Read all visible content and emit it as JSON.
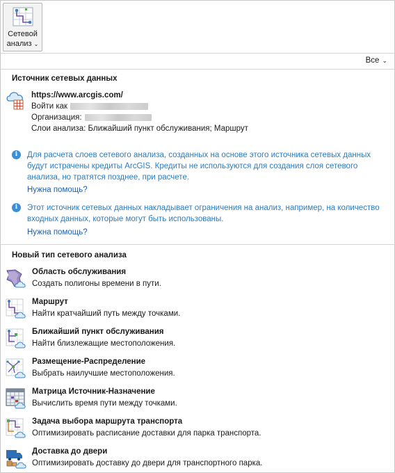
{
  "ribbon": {
    "button_line1": "Сетевой",
    "button_line2": "анализ",
    "button_icon": "network-grid-icon"
  },
  "filter": {
    "label": "Все"
  },
  "source": {
    "section_title": "Источник сетевых данных",
    "url": "https://www.arcgis.com/",
    "login_prefix": "Войти как",
    "org_prefix": "Организация:",
    "layers": "Слои анализа: Ближайший пункт обслуживания; Маршрут",
    "icon": "cloud-network-icon",
    "info1": "Для расчета слоев сетевого анализа, созданных на основе этого источника сетевых данных будут истрачены кредиты ArcGIS. Кредиты не используются для создания слоя сетевого анализа, но тратятся позднее, при расчете.",
    "help1": "Нужна помощь?",
    "info2": "Этот источник сетевых данных накладывает ограничения на анализ, например, на количество входных данных, которые могут быть использованы.",
    "help2": "Нужна помощь?"
  },
  "analysis": {
    "section_title": "Новый тип сетевого анализа",
    "items": [
      {
        "name": "Область обслуживания",
        "desc": "Создать полигоны времени в пути.",
        "icon": "service-area-icon"
      },
      {
        "name": "Маршрут",
        "desc": "Найти кратчайший путь между точками.",
        "icon": "route-icon"
      },
      {
        "name": "Ближайший пункт обслуживания",
        "desc": "Найти близлежащие местоположения.",
        "icon": "closest-facility-icon"
      },
      {
        "name": "Размещение-Распределение",
        "desc": "Выбрать наилучшие местоположения.",
        "icon": "location-allocation-icon"
      },
      {
        "name": "Матрица Источник-Назначение",
        "desc": "Вычислить время пути между точками.",
        "icon": "od-cost-matrix-icon"
      },
      {
        "name": "Задача выбора маршрута транспорта",
        "desc": "Оптимизировать расписание доставки для парка транспорта.",
        "icon": "vehicle-routing-icon"
      },
      {
        "name": "Доставка до двери",
        "desc": "Оптимизировать доставку до двери для транспортного парка.",
        "icon": "last-mile-delivery-icon"
      }
    ]
  }
}
